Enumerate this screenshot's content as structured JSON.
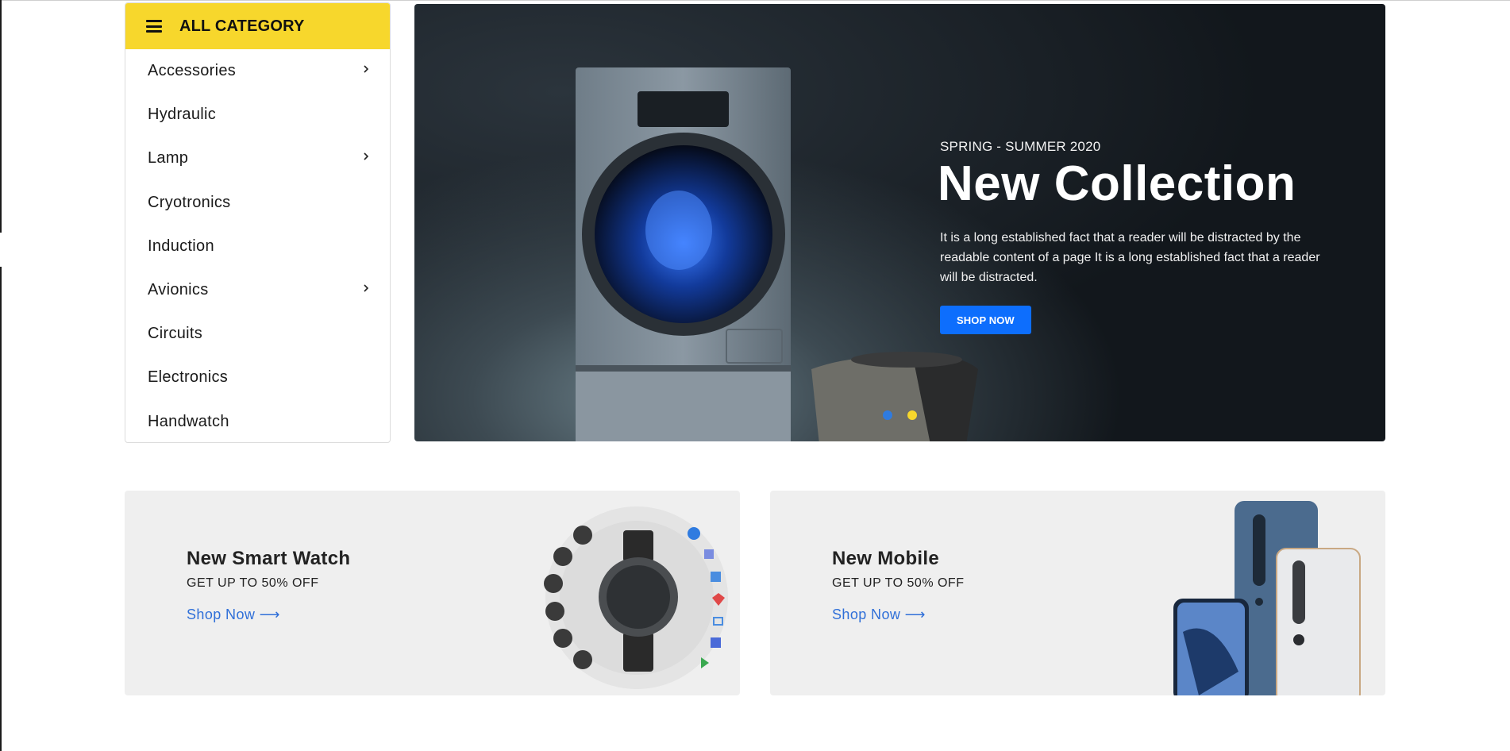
{
  "sidebar": {
    "title": "ALL CATEGORY",
    "items": [
      {
        "label": "Accessories",
        "has_submenu": true
      },
      {
        "label": "Hydraulic",
        "has_submenu": false
      },
      {
        "label": "Lamp",
        "has_submenu": true
      },
      {
        "label": "Cryotronics",
        "has_submenu": false
      },
      {
        "label": "Induction",
        "has_submenu": false
      },
      {
        "label": "Avionics",
        "has_submenu": true
      },
      {
        "label": "Circuits",
        "has_submenu": false
      },
      {
        "label": "Electronics",
        "has_submenu": false
      },
      {
        "label": "Handwatch",
        "has_submenu": false
      }
    ]
  },
  "hero": {
    "subtitle": "SPRING - SUMMER 2020",
    "title": "New Collection",
    "description": "It is a long established fact that a reader will be distracted by the readable content of a page It is a long established fact that a reader will be distracted.",
    "button_label": "SHOP NOW",
    "slides": [
      {
        "active": true,
        "color": "#2f7be0"
      },
      {
        "active": false,
        "color": "#f7d72c"
      }
    ]
  },
  "promos": [
    {
      "title": "New Smart Watch",
      "subtitle": "GET UP TO 50% OFF",
      "link": "Shop Now ⟶",
      "image": "smart-watch"
    },
    {
      "title": "New Mobile",
      "subtitle": "GET UP TO 50% OFF",
      "link": "Shop Now ⟶",
      "image": "mobile-phones"
    }
  ],
  "colors": {
    "accent_yellow": "#f7d72c",
    "button_blue": "#0d6efd",
    "link_blue": "#2f6fd8",
    "promo_bg": "#efefef"
  }
}
